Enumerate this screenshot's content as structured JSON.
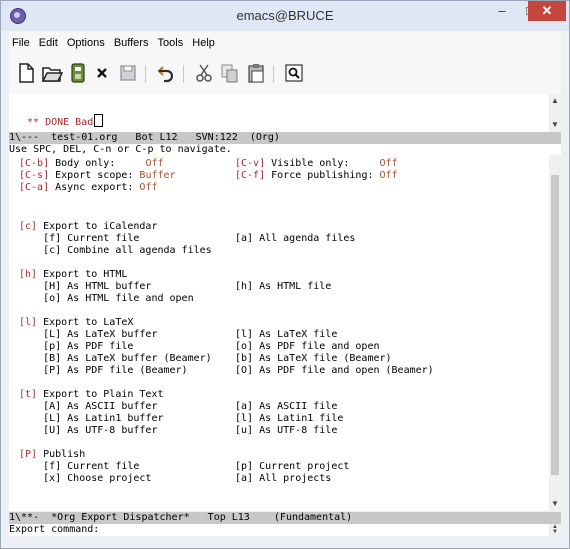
{
  "window": {
    "title": "emacs@BRUCE",
    "minimize_glyph": "–",
    "maximize_glyph": "□",
    "close_glyph": "✕"
  },
  "menubar": {
    "items": [
      "File",
      "Edit",
      "Options",
      "Buffers",
      "Tools",
      "Help"
    ]
  },
  "toolbar": {
    "icons": [
      "new-file-icon",
      "open-folder-icon",
      "save-icon",
      "close-buffer-icon",
      "save-as-icon",
      "undo-icon",
      "cut-icon",
      "copy-icon",
      "paste-icon",
      "search-icon"
    ]
  },
  "upper_buffer": {
    "stars": "** ",
    "todo": "DONE",
    "text": " Bad"
  },
  "upper_modeline": "1\\---  test-01.org   Bot L12   SVN:122  (Org)",
  "echo_line": "Use SPC, DEL, C-n or C-p to navigate.",
  "dispatcher": {
    "options": [
      {
        "key": "[C-b]",
        "label": " Body only:     ",
        "value": "Off",
        "key2": "[C-v]",
        "label2": " Visible only:     ",
        "value2": "Off"
      },
      {
        "key": "[C-s]",
        "label": " Export scope: ",
        "value": "Buffer",
        "key2": "[C-f]",
        "label2": " Force publishing: ",
        "value2": "Off"
      },
      {
        "key": "[C-a]",
        "label": " Async export: ",
        "value": "Off"
      }
    ],
    "sections": [
      {
        "key": "[c]",
        "title": " Export to iCalendar",
        "rows": [
          [
            "    [f] Current file",
            "[a] All agenda files"
          ],
          [
            "    [c] Combine all agenda files",
            ""
          ]
        ]
      },
      {
        "key": "[h]",
        "title": " Export to HTML",
        "rows": [
          [
            "    [H] As HTML buffer",
            "[h] As HTML file"
          ],
          [
            "    [o] As HTML file and open",
            ""
          ]
        ]
      },
      {
        "key": "[l]",
        "title": " Export to LaTeX",
        "rows": [
          [
            "    [L] As LaTeX buffer",
            "[l] As LaTeX file"
          ],
          [
            "    [p] As PDF file",
            "[o] As PDF file and open"
          ],
          [
            "    [B] As LaTeX buffer (Beamer)",
            "[b] As LaTeX file (Beamer)"
          ],
          [
            "    [P] As PDF file (Beamer)",
            "[O] As PDF file and open (Beamer)"
          ]
        ]
      },
      {
        "key": "[t]",
        "title": " Export to Plain Text",
        "rows": [
          [
            "    [A] As ASCII buffer",
            "[a] As ASCII file"
          ],
          [
            "    [L] As Latin1 buffer",
            "[l] As Latin1 file"
          ],
          [
            "    [U] As UTF-8 buffer",
            "[u] As UTF-8 file"
          ]
        ]
      },
      {
        "key": "[P]",
        "title": " Publish",
        "rows": [
          [
            "    [f] Current file",
            "[p] Current project"
          ],
          [
            "    [x] Choose project",
            "[a] All projects"
          ]
        ]
      }
    ]
  },
  "lower_modeline": "1\\**-  *Org Export Dispatcher*   Top L13    (Fundamental)",
  "minibuffer": "Export command: ",
  "colors": {
    "keyword": "#a52a2a",
    "value": "#a0522d",
    "close_button": "#c7463c",
    "modeline": "#c8c8c8"
  }
}
